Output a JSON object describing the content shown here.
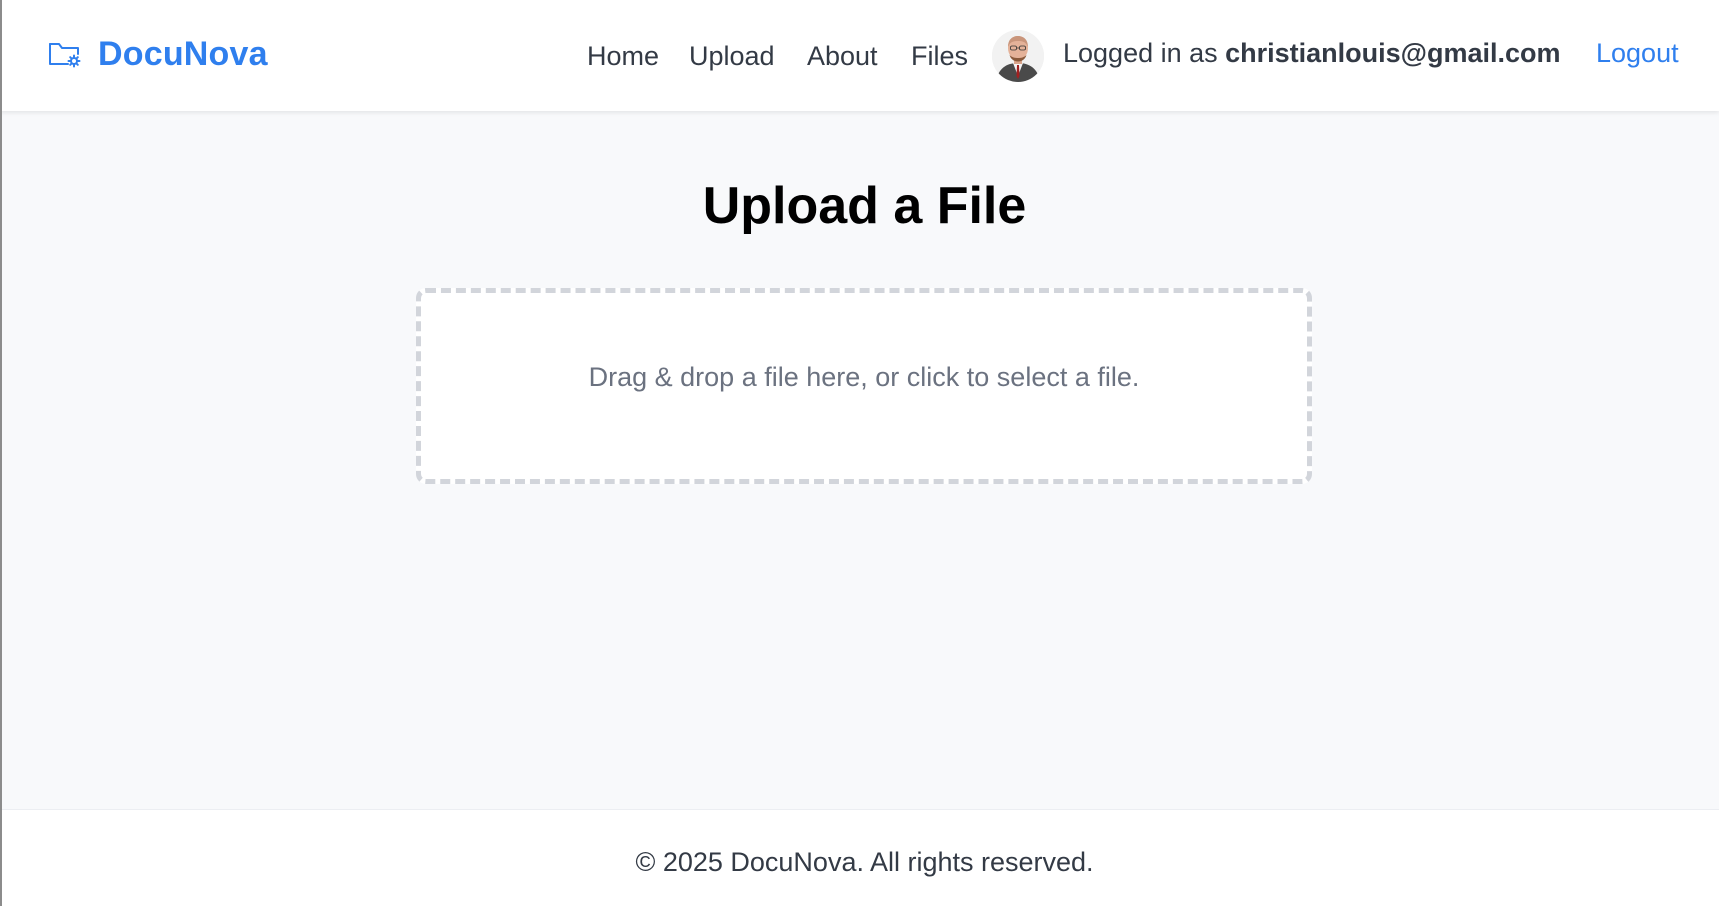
{
  "header": {
    "brand": {
      "name": "DocuNova",
      "icon": "folder-gear-icon",
      "color": "#2f7fee"
    },
    "nav": [
      {
        "label": "Home"
      },
      {
        "label": "Upload"
      },
      {
        "label": "About"
      },
      {
        "label": "Files"
      }
    ],
    "user": {
      "avatar_icon": "user-avatar",
      "prefix": "Logged in as ",
      "email": "christianlouis@gmail.com"
    },
    "logout_label": "Logout"
  },
  "main": {
    "title": "Upload a File",
    "dropzone": {
      "text": "Drag & drop a file here, or click to select a file."
    }
  },
  "footer": {
    "text": "© 2025 DocuNova. All rights reserved."
  }
}
